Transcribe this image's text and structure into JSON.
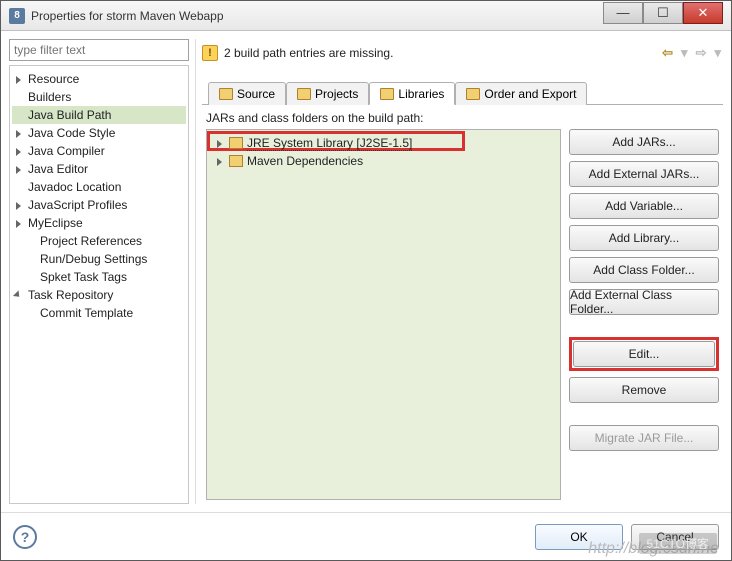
{
  "window": {
    "title": "Properties for storm Maven Webapp"
  },
  "filter": {
    "placeholder": "type filter text"
  },
  "tree": [
    {
      "label": "Resource",
      "expandable": true
    },
    {
      "label": "Builders"
    },
    {
      "label": "Java Build Path",
      "selected": true
    },
    {
      "label": "Java Code Style",
      "expandable": true
    },
    {
      "label": "Java Compiler",
      "expandable": true
    },
    {
      "label": "Java Editor",
      "expandable": true
    },
    {
      "label": "Javadoc Location"
    },
    {
      "label": "JavaScript Profiles",
      "expandable": true
    },
    {
      "label": "MyEclipse",
      "expandable": true
    },
    {
      "label": "Project References",
      "child": true
    },
    {
      "label": "Run/Debug Settings",
      "child": true
    },
    {
      "label": "Spket Task Tags",
      "child": true
    },
    {
      "label": "Task Repository",
      "expandable": true,
      "expanded": true
    },
    {
      "label": "Commit Template",
      "child": true
    }
  ],
  "header": {
    "warning": "2 build path entries are missing."
  },
  "tabs": [
    {
      "label": "Source"
    },
    {
      "label": "Projects"
    },
    {
      "label": "Libraries",
      "active": true
    },
    {
      "label": "Order and Export"
    }
  ],
  "section_label": "JARs and class folders on the build path:",
  "jar_items": [
    {
      "label": "JRE System Library [J2SE-1.5]",
      "selected": true
    },
    {
      "label": "Maven Dependencies"
    }
  ],
  "buttons": {
    "add_jars": "Add JARs...",
    "add_external_jars": "Add External JARs...",
    "add_variable": "Add Variable...",
    "add_library": "Add Library...",
    "add_class_folder": "Add Class Folder...",
    "add_external_class_folder": "Add External Class Folder...",
    "edit": "Edit...",
    "remove": "Remove",
    "migrate": "Migrate JAR File..."
  },
  "footer": {
    "ok": "OK",
    "cancel": "Cancel"
  },
  "watermark": "http://blog.csdn.ne",
  "wm_badge": "51CTO博客"
}
